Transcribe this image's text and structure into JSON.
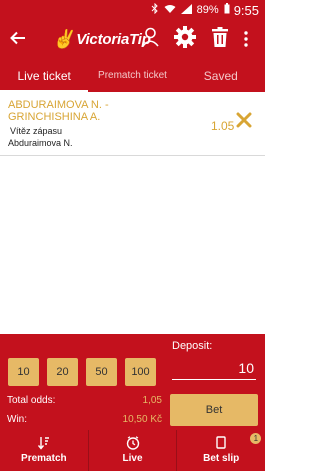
{
  "status_bar": {
    "bluetooth_icon": "bluetooth-icon",
    "wifi_icon": "wifi-icon",
    "signal_icon": "signal-icon",
    "battery_text": "89%",
    "time": "9:55"
  },
  "app_bar": {
    "back_icon": "arrow-left-icon",
    "logo_text": "VictoriaTip",
    "icons": [
      "user-icon",
      "gear-icon",
      "trash-icon",
      "more-vert-icon"
    ]
  },
  "tabs": [
    {
      "label": "Live ticket",
      "active": true
    },
    {
      "label": "Prematch ticket",
      "active": false
    },
    {
      "label": "Saved",
      "active": false
    }
  ],
  "bet": {
    "match": "ABDURAIMOVA N. - GRINCHISHINA A.",
    "market": "Vítěz zápasu",
    "pick": "Abduraimova N.",
    "odd": "1.05",
    "remove_icon": "close-icon"
  },
  "stake_buttons": [
    "10",
    "20",
    "50",
    "100"
  ],
  "deposit": {
    "label": "Deposit:",
    "value": "10"
  },
  "totals": {
    "total_odds_label": "Total odds:",
    "total_odds_value": "1,05",
    "win_label": "Win:",
    "win_value": "10,50 Kč"
  },
  "bet_button_label": "Bet",
  "bottom_nav": [
    {
      "label": "Prematch",
      "icon": "sort-icon"
    },
    {
      "label": "Live",
      "icon": "clock-icon"
    },
    {
      "label": "Bet slip",
      "icon": "slip-icon",
      "badge": "1"
    }
  ],
  "colors": {
    "primary": "#c3111d",
    "accent": "#e6b966",
    "odd_text": "#d8a534"
  }
}
